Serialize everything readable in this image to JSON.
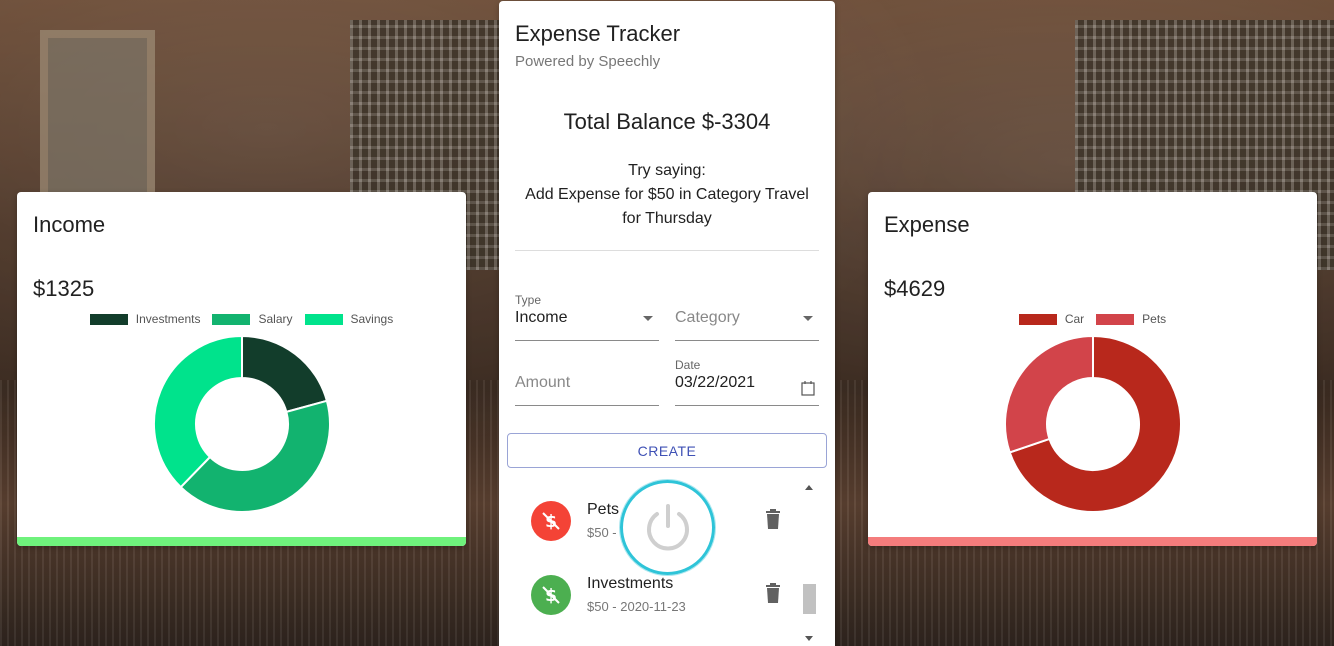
{
  "app": {
    "title": "Expense Tracker",
    "subtitle": "Powered by Speechly",
    "balance": "Total Balance $-3304",
    "hint": "Try saying:\nAdd Expense for $50 in Category Travel for Thursday"
  },
  "form": {
    "type_label": "Type",
    "type_value": "Income",
    "category_placeholder": "Category",
    "amount_placeholder": "Amount",
    "date_label": "Date",
    "date_value": "03/22/2021",
    "create_label": "CREATE"
  },
  "transactions": [
    {
      "name": "Pets",
      "detail": "$50 - ",
      "type": "expense",
      "color": "#f44336"
    },
    {
      "name": "Investments",
      "detail": "$50 - 2020-11-23",
      "type": "income",
      "color": "#4caf50"
    }
  ],
  "income_card": {
    "title": "Income",
    "amount": "$1325",
    "bar_color": "#6ff27c",
    "chart_data": {
      "type": "pie",
      "categories": [
        "Investments",
        "Salary",
        "Savings"
      ],
      "colors": [
        "#123d2b",
        "#12b36f",
        "#00e38c"
      ],
      "values": [
        275,
        550,
        500
      ]
    }
  },
  "expense_card": {
    "title": "Expense",
    "amount": "$4629",
    "bar_color": "#f47c7c",
    "chart_data": {
      "type": "pie",
      "categories": [
        "Car",
        "Pets"
      ],
      "colors": [
        "#b8281c",
        "#d2444a"
      ],
      "values": [
        3229,
        1400
      ]
    }
  },
  "icons": {
    "dollar": "dollar-off-icon",
    "delete": "trash-icon",
    "calendar": "calendar-icon",
    "dropdown": "chevron-down-icon",
    "mic": "power-icon"
  }
}
